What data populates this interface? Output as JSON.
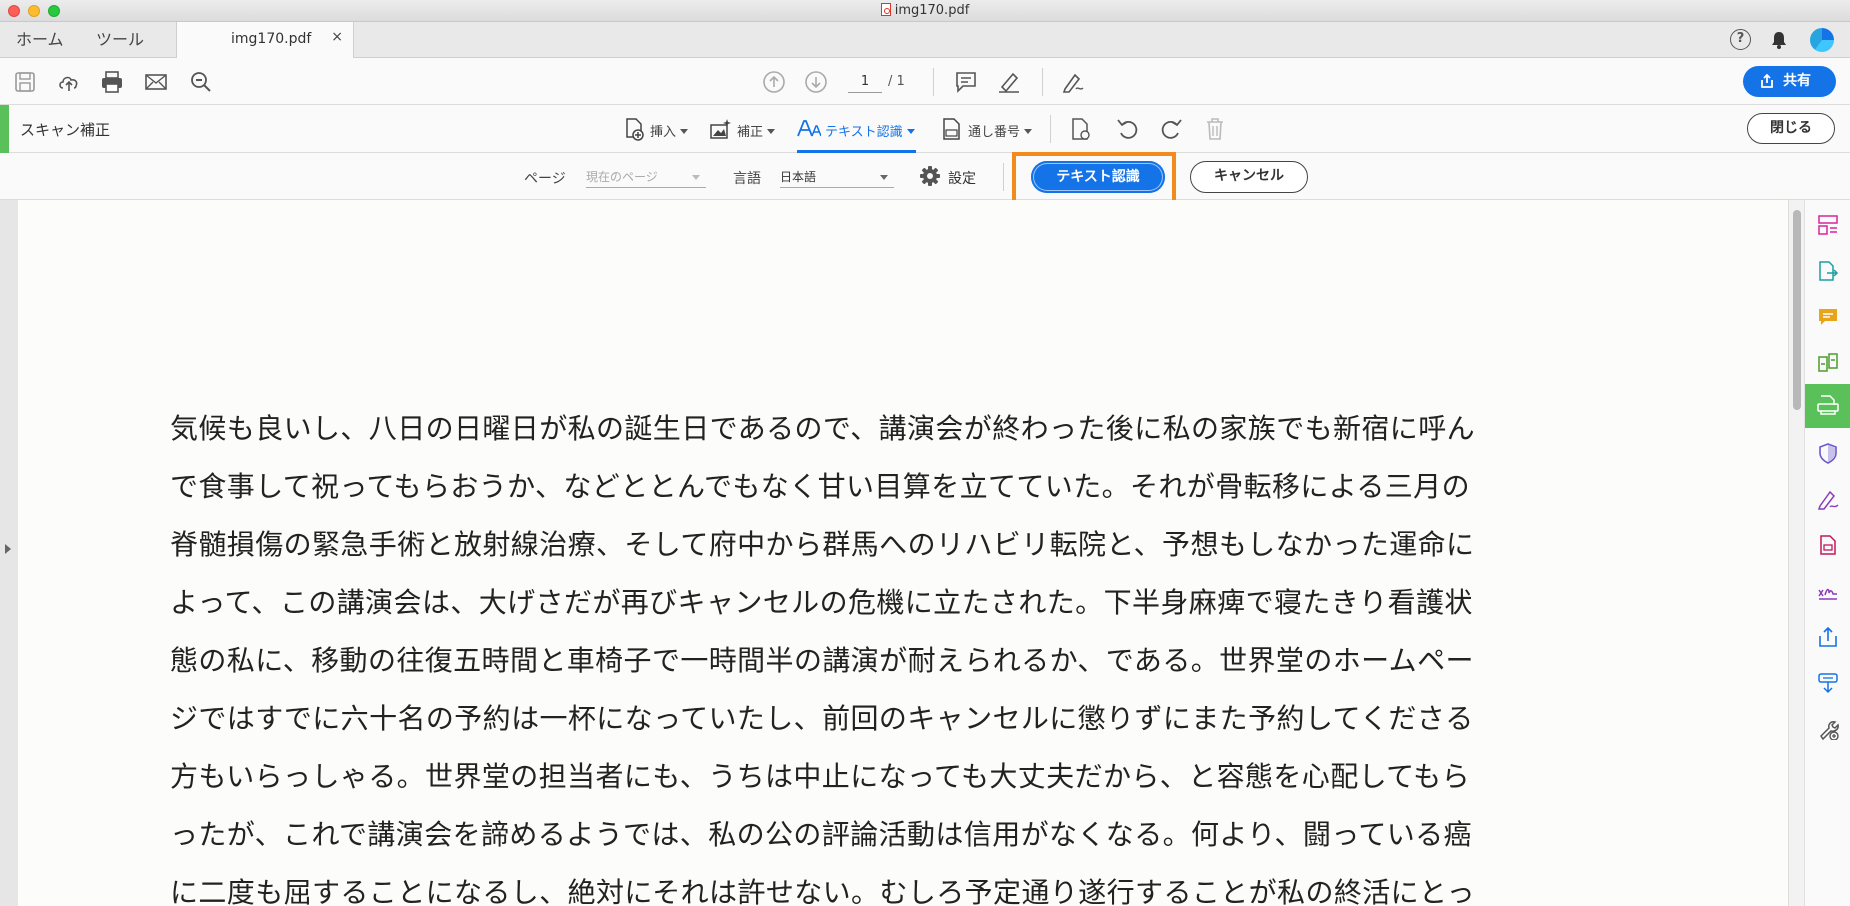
{
  "window": {
    "title": "img170.pdf"
  },
  "tabs": {
    "home": "ホーム",
    "tools": "ツール",
    "document": "img170.pdf",
    "close": "×"
  },
  "toolbar": {
    "page_current": "1",
    "page_total": "/ 1",
    "share_label": "共有"
  },
  "scan": {
    "title": "スキャン補正",
    "tools": [
      {
        "label": "挿入",
        "icon": "insert-page-icon"
      },
      {
        "label": "補正",
        "icon": "enhance-icon"
      },
      {
        "label": "テキスト認識",
        "icon": "text-recognition-icon",
        "active": true
      },
      {
        "label": "通し番号",
        "icon": "bates-number-icon"
      }
    ],
    "close_label": "閉じる"
  },
  "ocr": {
    "page_label": "ページ",
    "page_value": "現在のページ",
    "language_label": "言語",
    "language_value": "日本語",
    "settings_label": "設定",
    "recognize_button": "テキスト認識",
    "cancel_button": "キャンセル"
  },
  "document": {
    "lines": [
      "気候も良いし、八日の日曜日が私の誕生日であるので、講演会が終わった後に私の家族でも新宿に呼ん",
      "で食事して祝ってもらおうか、などととんでもなく甘い目算を立てていた。それが骨転移による三月の",
      "脊髄損傷の緊急手術と放射線治療、そして府中から群馬へのリハビリ転院と、予想もしなかった運命に",
      "よって、この講演会は、大げさだが再びキャンセルの危機に立たされた。下半身麻痺で寝たきり看護状",
      "態の私に、移動の往復五時間と車椅子で一時間半の講演が耐えられるか、である。世界堂のホームペー",
      "ジではすでに六十名の予約は一杯になっていたし、前回のキャンセルに懲りずにまた予約してくださる",
      "方もいらっしゃる。世界堂の担当者にも、うちは中止になっても大丈夫だから、と容態を心配してもら",
      "ったが、これで講演会を諦めるようでは、私の公の評論活動は信用がなくなる。何より、闘っている癌",
      "に二度も屈することになるし、絶対にそれは許せない。むしろ予定通り遂行することが私の終活にとっ"
    ]
  },
  "colors": {
    "accent": "#1473e6",
    "highlight": "#f28a1d",
    "scan_green": "#5ac05a"
  }
}
